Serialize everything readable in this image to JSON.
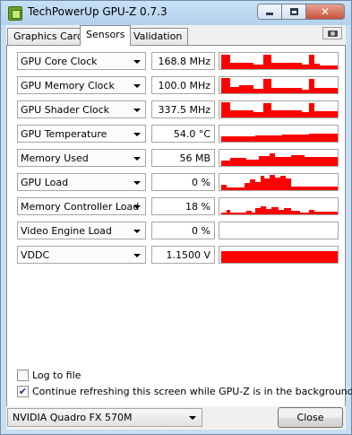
{
  "window": {
    "title": "TechPowerUp GPU-Z 0.7.3",
    "close_glyph": "✕"
  },
  "tabs": [
    {
      "label": "Graphics Card"
    },
    {
      "label": "Sensors"
    },
    {
      "label": "Validation"
    }
  ],
  "sensors": [
    {
      "name": "GPU Core Clock",
      "value": "168.8 MHz"
    },
    {
      "name": "GPU Memory Clock",
      "value": "100.0 MHz"
    },
    {
      "name": "GPU Shader Clock",
      "value": "337.5 MHz"
    },
    {
      "name": "GPU Temperature",
      "value": "54.0 °C"
    },
    {
      "name": "Memory Used",
      "value": "56 MB"
    },
    {
      "name": "GPU Load",
      "value": "0 %"
    },
    {
      "name": "Memory Controller Load",
      "value": "18 %"
    },
    {
      "name": "Video Engine Load",
      "value": "0 %"
    },
    {
      "name": "VDDC",
      "value": "1.1500 V"
    }
  ],
  "options": {
    "log_to_file": {
      "label": "Log to file",
      "checked": false
    },
    "continue_refreshing": {
      "label": "Continue refreshing this screen while GPU-Z is in the background",
      "checked": true
    }
  },
  "gpu_selector": {
    "selected": "NVIDIA Quadro FX 570M"
  },
  "close_button": {
    "label": "Close"
  },
  "colors": {
    "graph": "#ff0000",
    "window_frame": "#c9dff1"
  }
}
